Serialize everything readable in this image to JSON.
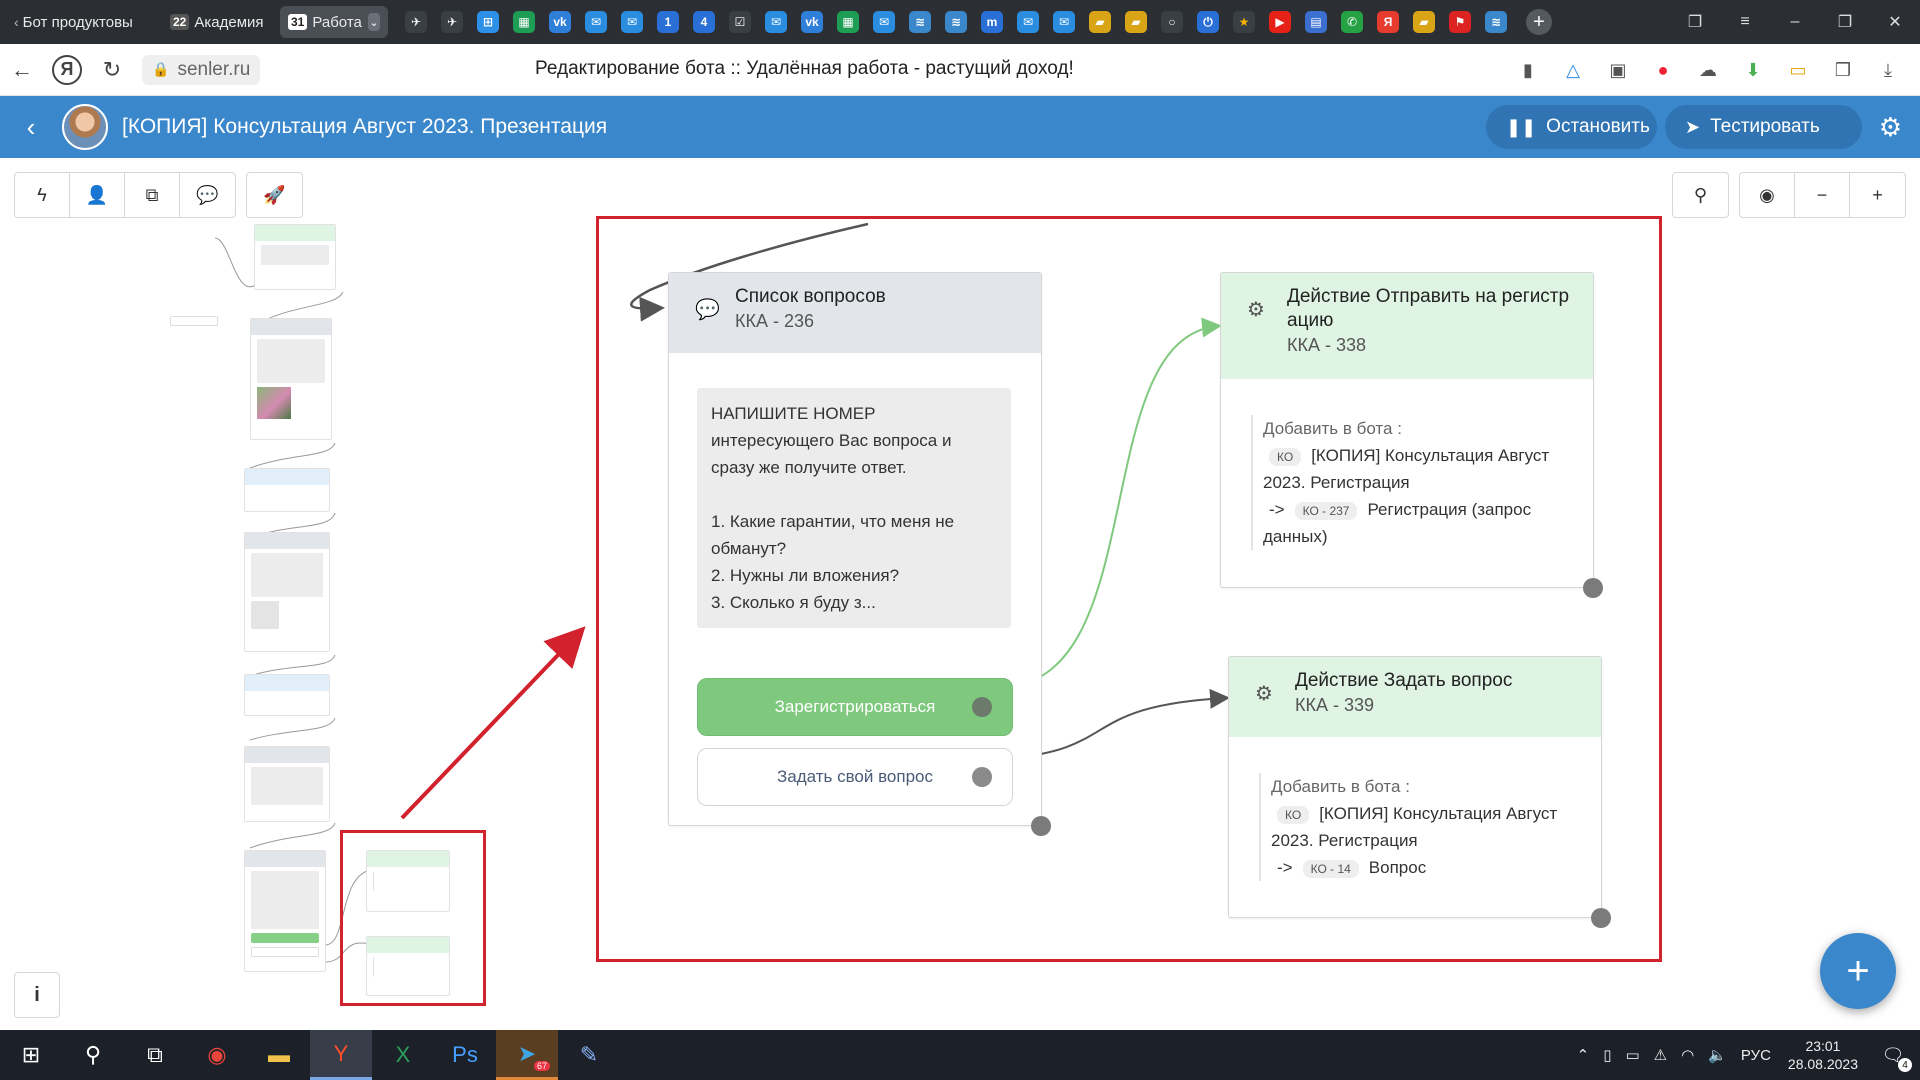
{
  "browser": {
    "tabs": [
      {
        "label": "Бот продуктовы",
        "badge": ""
      },
      {
        "label": "Академия",
        "badge": "22"
      },
      {
        "label": "Работа",
        "badge": "31"
      }
    ],
    "new_tab_label": "+",
    "favicons": [
      "plane-icon",
      "plane-icon",
      "plus-square-icon",
      "sheets-icon",
      "vk-icon",
      "chat-icon",
      "chat-icon",
      "one-icon",
      "four-icon",
      "check-icon",
      "chat-icon",
      "vk-icon",
      "sheets-icon",
      "chat-icon",
      "senler-icon",
      "senler-icon",
      "m-icon",
      "chat-icon",
      "chat-icon",
      "bank-icon",
      "bank-icon",
      "circle-icon",
      "power-icon",
      "star-icon",
      "youtube-icon",
      "doc-icon",
      "whatsapp-icon",
      "yandex-icon",
      "bank-icon",
      "flag-icon",
      "senler-icon"
    ]
  },
  "address_bar": {
    "url": "senler.ru",
    "page_title": "Редактирование бота :: Удалённая работа - растущий доход!"
  },
  "app": {
    "bot_title": "[КОПИЯ] Консультация Август 2023. Презентация",
    "stop_label": "Остановить",
    "test_label": "Тестировать",
    "accent_color": "#3b87cc"
  },
  "canvas": {
    "fab_label": "+",
    "info_label": "i",
    "question_node": {
      "title": "Список вопросов",
      "sub": "ККА - 236",
      "message_lines": [
        "НАПИШИТЕ НОМЕР",
        "интересующего Вас вопроса и",
        "сразу же получите ответ.",
        "",
        "1. Какие гарантии, что меня не",
        "обманут?",
        "2. Нужны ли вложения?",
        "3. Сколько я буду з..."
      ],
      "buttons": [
        {
          "label": "Зарегистрироваться",
          "style": "green"
        },
        {
          "label": "Задать свой вопрос",
          "style": "white"
        }
      ]
    },
    "action_nodes": [
      {
        "title_line1": "Действие Отправить на регистр",
        "title_line2": "ацию",
        "sub": "ККА - 338",
        "add_label": "Добавить в бота :",
        "bot_pill": "КО",
        "bot_name_line1": "[КОПИЯ] Консультация Август",
        "bot_name_line2": "2023. Регистрация",
        "arrow": "->",
        "step_pill": "КО - 237",
        "step_line1": "Регистрация (запрос",
        "step_line2": "данных)"
      },
      {
        "title_line1": "Действие Задать вопрос",
        "title_line2": "",
        "sub": "ККА - 339",
        "add_label": "Добавить в бота :",
        "bot_pill": "КО",
        "bot_name_line1": "[КОПИЯ] Консультация Август",
        "bot_name_line2": "2023. Регистрация",
        "arrow": "->",
        "step_pill": "КО - 14",
        "step_line1": "Вопрос",
        "step_line2": ""
      }
    ]
  },
  "taskbar": {
    "telegram_badge": "67",
    "lang": "РУС",
    "time": "23:01",
    "date": "28.08.2023",
    "notification_count": "4"
  }
}
